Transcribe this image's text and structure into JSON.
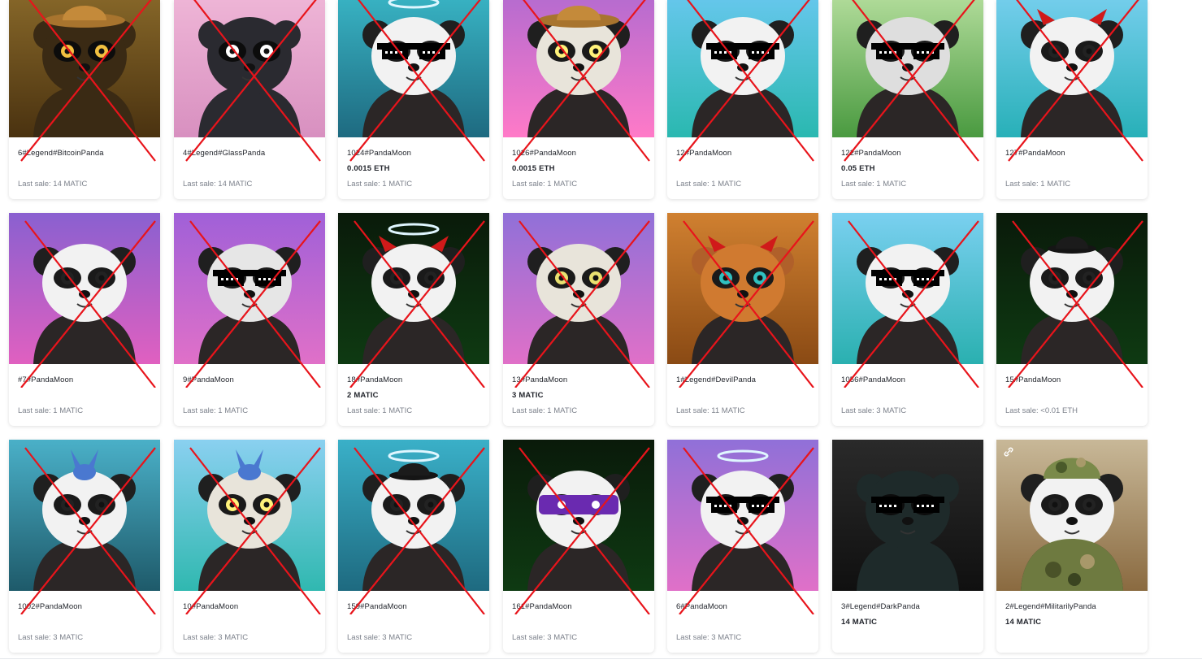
{
  "colors": {
    "cross": "#e8141b",
    "name_text": "#23262d",
    "muted_text": "#7d828c"
  },
  "cards": [
    {
      "name": "6#Legend#BitcoinPanda",
      "price": "",
      "last_sale": "Last sale: 14 MATIC",
      "crossed": true,
      "bg": [
        "#8a6a2a",
        "#4a3210"
      ],
      "char": "#3a2a14",
      "eyes": "#f2c040",
      "hat": "cowboy",
      "glasses": false
    },
    {
      "name": "4#Legend#GlassPanda",
      "price": "",
      "last_sale": "Last sale: 14 MATIC",
      "crossed": true,
      "bg": [
        "#f0b8d8",
        "#d890c0"
      ],
      "char": "#2a2a30",
      "eyes": "#ffffff",
      "hat": "none",
      "glasses": false
    },
    {
      "name": "1024#PandaMoon",
      "price": "0.0015 ETH",
      "last_sale": "Last sale: 1 MATIC",
      "crossed": true,
      "bg": [
        "#3ab8c8",
        "#1e6a80"
      ],
      "char": "#f2f2f2",
      "eyes": "#222222",
      "hat": "halo",
      "glasses": true
    },
    {
      "name": "1026#PandaMoon",
      "price": "0.0015 ETH",
      "last_sale": "Last sale: 1 MATIC",
      "crossed": true,
      "bg": [
        "#b06ad0",
        "#ff7ac8"
      ],
      "char": "#e8e4da",
      "eyes": "#fff27a",
      "hat": "cowboy",
      "glasses": false
    },
    {
      "name": "12#PandaMoon",
      "price": "",
      "last_sale": "Last sale: 1 MATIC",
      "crossed": true,
      "bg": [
        "#6ac8f0",
        "#2ab8b0"
      ],
      "char": "#f2f2f2",
      "eyes": "#222222",
      "hat": "none",
      "glasses": true
    },
    {
      "name": "122#PandaMoon",
      "price": "0.05 ETH",
      "last_sale": "Last sale: 1 MATIC",
      "crossed": true,
      "bg": [
        "#b8e0a0",
        "#4a9a40"
      ],
      "char": "#dedede",
      "eyes": "#222222",
      "hat": "none",
      "glasses": true
    },
    {
      "name": "127#PandaMoon",
      "price": "",
      "last_sale": "Last sale: 1 MATIC",
      "crossed": true,
      "bg": [
        "#7ad0f0",
        "#28b0b8"
      ],
      "char": "#f2f2f2",
      "eyes": "#222222",
      "hat": "horns",
      "glasses": false
    },
    {
      "name": "#7#PandaMoon",
      "price": "",
      "last_sale": "Last sale: 1 MATIC",
      "crossed": true,
      "bg": [
        "#8a60d0",
        "#e060c0"
      ],
      "char": "#f2f2f2",
      "eyes": "#222222",
      "hat": "none",
      "glasses": false
    },
    {
      "name": "9#PandaMoon",
      "price": "",
      "last_sale": "Last sale: 1 MATIC",
      "crossed": true,
      "bg": [
        "#a060d8",
        "#e070c8"
      ],
      "char": "#e6e6e6",
      "eyes": "#222222",
      "hat": "none",
      "glasses": true
    },
    {
      "name": "18#PandaMoon",
      "price": "2 MATIC",
      "last_sale": "Last sale: 1 MATIC",
      "crossed": true,
      "bg": [
        "#0a1a0a",
        "#0e3a12"
      ],
      "char": "#f2f2f2",
      "eyes": "#222222",
      "hat": "halo-horns",
      "glasses": false
    },
    {
      "name": "13#PandaMoon",
      "price": "3 MATIC",
      "last_sale": "Last sale: 1 MATIC",
      "crossed": true,
      "bg": [
        "#9070d8",
        "#e070c8"
      ],
      "char": "#e8e4da",
      "eyes": "#e8e070",
      "hat": "none",
      "glasses": false
    },
    {
      "name": "1#Legend#DevilPanda",
      "price": "",
      "last_sale": "Last sale: 11 MATIC",
      "crossed": true,
      "bg": [
        "#d08030",
        "#8a4a14"
      ],
      "char": "#d07a30",
      "eyes": "#30c0c0",
      "hat": "horns",
      "glasses": false
    },
    {
      "name": "1056#PandaMoon",
      "price": "",
      "last_sale": "Last sale: 3 MATIC",
      "crossed": true,
      "bg": [
        "#7ad0f0",
        "#2ab0b0"
      ],
      "char": "#f2f2f2",
      "eyes": "#222222",
      "hat": "none",
      "glasses": true
    },
    {
      "name": "15#PandaMoon",
      "price": "",
      "last_sale": "Last sale: <0.01 ETH",
      "crossed": true,
      "bg": [
        "#0a1a0a",
        "#0e3a12"
      ],
      "char": "#f2f2f2",
      "eyes": "#222222",
      "hat": "bowler",
      "glasses": false
    },
    {
      "name": "1002#PandaMoon",
      "price": "",
      "last_sale": "Last sale: 3 MATIC",
      "crossed": true,
      "bg": [
        "#4ab0c8",
        "#1e5a6a"
      ],
      "char": "#f2f2f2",
      "eyes": "#222222",
      "hat": "stitch",
      "glasses": false
    },
    {
      "name": "10#PandaMoon",
      "price": "",
      "last_sale": "Last sale: 3 MATIC",
      "crossed": true,
      "bg": [
        "#8ad0f0",
        "#30b8b0"
      ],
      "char": "#e8e4da",
      "eyes": "#fff27a",
      "hat": "stitch",
      "glasses": false
    },
    {
      "name": "159#PandaMoon",
      "price": "",
      "last_sale": "Last sale: 3 MATIC",
      "crossed": true,
      "bg": [
        "#3ab0c8",
        "#1e6a80"
      ],
      "char": "#f2f2f2",
      "eyes": "#222222",
      "hat": "halo-bowler",
      "glasses": false
    },
    {
      "name": "161#PandaMoon",
      "price": "",
      "last_sale": "Last sale: 3 MATIC",
      "crossed": true,
      "bg": [
        "#0a1a0a",
        "#0e3a12"
      ],
      "char": "#f2f2f2",
      "eyes": "#222222",
      "hat": "bandana",
      "glasses": false
    },
    {
      "name": "6#PandaMoon",
      "price": "",
      "last_sale": "Last sale: 3 MATIC",
      "crossed": true,
      "bg": [
        "#9070d8",
        "#e070c8"
      ],
      "char": "#f2f2f2",
      "eyes": "#222222",
      "hat": "halo",
      "glasses": true
    },
    {
      "name": "3#Legend#DarkPanda",
      "price": "14 MATIC",
      "last_sale": "",
      "crossed": false,
      "bg": [
        "#2a2a2a",
        "#101010"
      ],
      "char": "#1e2a2a",
      "eyes": "#222222",
      "hat": "none",
      "glasses": true
    },
    {
      "name": "2#Legend#MilitarilyPanda",
      "price": "14 MATIC",
      "last_sale": "",
      "crossed": false,
      "bg": [
        "#c8b898",
        "#8a6a40"
      ],
      "char": "#f2f2f2",
      "eyes": "#222222",
      "hat": "camo",
      "glasses": false,
      "link_icon": true
    }
  ]
}
